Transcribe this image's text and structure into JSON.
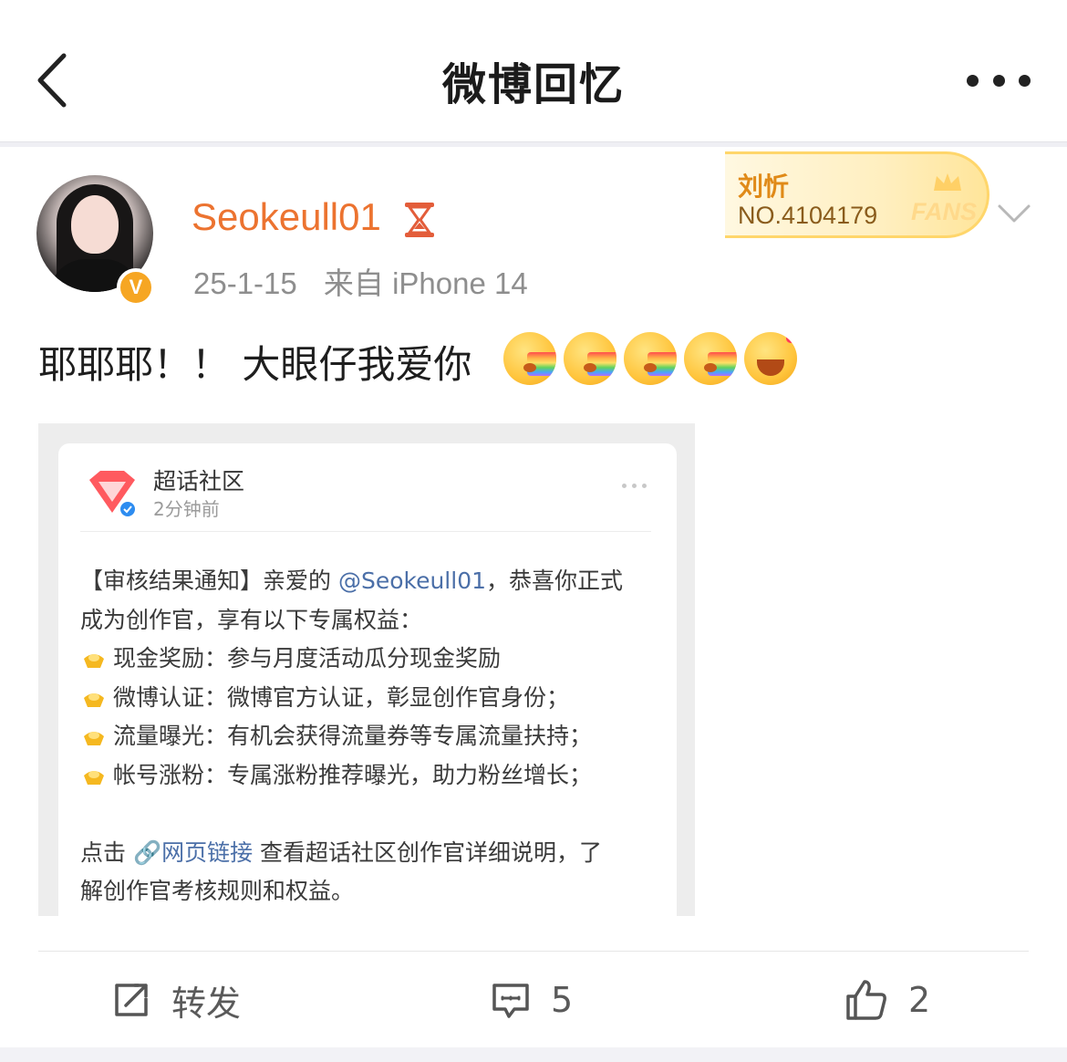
{
  "header": {
    "title": "微博回忆",
    "back_icon": "chevron-left-icon",
    "more_icon": "more-dots-icon"
  },
  "author": {
    "username": "Seokeull01",
    "date": "25-1-15",
    "source": "来自 iPhone 14",
    "verified_badge": "V",
    "badge_color": "#f6a623",
    "username_color": "#ec7330"
  },
  "fans_badge": {
    "name": "刘忻",
    "number": "NO.4104179",
    "label": "FANS"
  },
  "post": {
    "text": "耶耶耶！！ 大眼仔我爱你",
    "emojis": [
      "rainbow-vomit-emoji",
      "rainbow-vomit-emoji",
      "rainbow-vomit-emoji",
      "rainbow-vomit-emoji",
      "happy-emoji"
    ]
  },
  "embed": {
    "author": "超话社区",
    "time": "2分钟前",
    "line1_pre": "【审核结果通知】亲爱的 ",
    "mention": "@Seokeull01",
    "line1_post": "，恭喜你正式",
    "line2": "成为创作官，享有以下专属权益：",
    "benefits": [
      "现金奖励：参与月度活动瓜分现金奖励",
      "微博认证：微博官方认证，彰显创作官身份；",
      "流量曝光：有机会获得流量券等专属流量扶持；",
      "帐号涨粉：专属涨粉推荐曝光，助力粉丝增长；"
    ],
    "click_pre": "点击 ",
    "link_text": "网页链接",
    "click_post": " 查看超话社区创作官详细说明，了",
    "last_line": "解创作官考核规则和权益。"
  },
  "actions": {
    "repost_label": "转发",
    "comment_count": "5",
    "like_count": "2"
  }
}
